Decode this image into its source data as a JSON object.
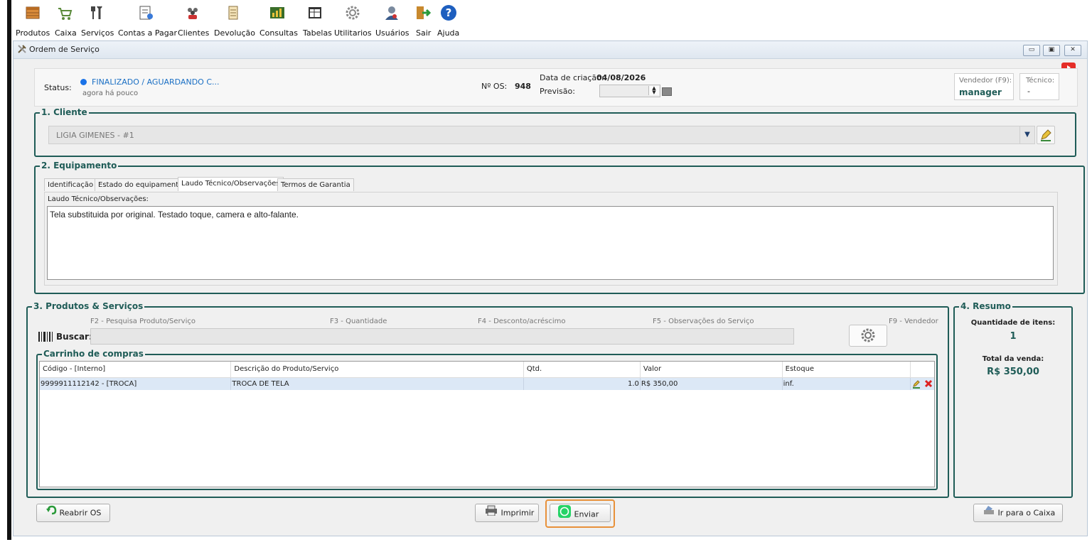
{
  "toolbar": {
    "items": [
      {
        "label": "Produtos",
        "icon": "products-icon"
      },
      {
        "label": "Caixa",
        "icon": "cart-icon"
      },
      {
        "label": "Serviços",
        "icon": "tools-icon"
      },
      {
        "label": "Contas a Pagar",
        "icon": "bills-icon"
      },
      {
        "label": "Clientes",
        "icon": "clients-icon"
      },
      {
        "label": "Devolução",
        "icon": "return-icon"
      },
      {
        "label": "Consultas",
        "icon": "reports-icon"
      },
      {
        "label": "Tabelas",
        "icon": "tables-icon"
      },
      {
        "label": "Utilitarios",
        "icon": "gear-icon"
      },
      {
        "label": "Usuários",
        "icon": "users-icon"
      },
      {
        "label": "Sair",
        "icon": "exit-icon"
      },
      {
        "label": "Ajuda",
        "icon": "help-icon"
      }
    ]
  },
  "window": {
    "title": "Ordem de Serviço"
  },
  "header": {
    "status_label": "Status:",
    "status_value": "FINALIZADO / AGUARDANDO C...",
    "status_time": "agora há pouco",
    "os_label": "Nº OS:",
    "os_value": "948",
    "created_label": "Data de criação:",
    "created_value": "04/08/2026",
    "forecast_label": "Previsão:",
    "seller_label": "Vendedor (F9):",
    "seller_value": "manager",
    "tech_label": "Técnico:",
    "tech_value": "-"
  },
  "cliente": {
    "title": "1. Cliente",
    "value": "LIGIA GIMENES - #1"
  },
  "equipamento": {
    "title": "2. Equipamento",
    "tabs": [
      "Identificação",
      "Estado do equipamento",
      "Laudo Técnico/Observações",
      "Termos de Garantia"
    ],
    "field_label": "Laudo Técnico/Observações:",
    "field_value": "Tela substituida por original. Testado toque, camera e alto-falante."
  },
  "produtos": {
    "title": "3. Produtos & Serviços",
    "shortcuts": [
      "F2 - Pesquisa Produto/Serviço",
      "F3 - Quantidade",
      "F4 - Desconto/acréscimo",
      "F5 - Observações do Serviço",
      "F9 - Vendedor"
    ],
    "search_label": "Buscar:",
    "cart_title": "Carrinho de compras",
    "columns": [
      "Código - [Interno]",
      "Descrição do Produto/Serviço",
      "Qtd.",
      "Valor",
      "Estoque"
    ],
    "rows": [
      {
        "code": "9999911112142 - [TROCA]",
        "desc": "TROCA DE TELA",
        "qty": "1.0",
        "value": "R$ 350,00",
        "stock": "inf."
      }
    ]
  },
  "resumo": {
    "title": "4. Resumo",
    "qty_label": "Quantidade de itens:",
    "qty_value": "1",
    "total_label": "Total da venda:",
    "total_value": "R$ 350,00"
  },
  "footer": {
    "reopen": "Reabrir OS",
    "print": "Imprimir",
    "send": "Enviar",
    "cashier": "Ir para o Caixa"
  },
  "colors": {
    "accent": "#1f5c57",
    "status_dot": "#1a73e8",
    "highlight": "#e8913a",
    "row_selected": "#dce8f6"
  }
}
